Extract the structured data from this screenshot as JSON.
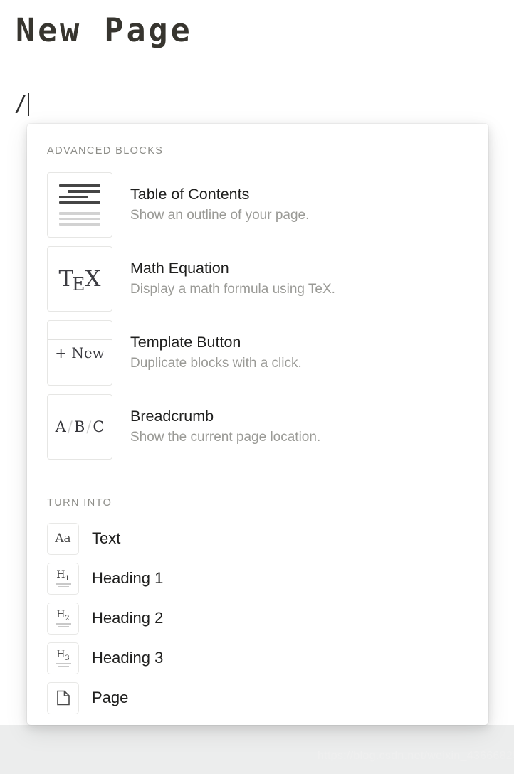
{
  "page": {
    "title": "New Page",
    "typed_text": "/",
    "caret_visible": true
  },
  "slash_menu": {
    "sections": [
      {
        "header": "ADVANCED BLOCKS",
        "items": [
          {
            "title": "Table of Contents",
            "description": "Show an outline of your page.",
            "icon": "table-of-contents-icon"
          },
          {
            "title": "Math Equation",
            "description": "Display a math formula using TeX.",
            "icon": "tex-logo-icon",
            "icon_text": "TEX"
          },
          {
            "title": "Template Button",
            "description": "Duplicate blocks with a click.",
            "icon": "new-template-button-icon",
            "icon_text": "+ New"
          },
          {
            "title": "Breadcrumb",
            "description": "Show the current page location.",
            "icon": "breadcrumb-abc-icon",
            "icon_text": "A / B / C"
          }
        ]
      },
      {
        "header": "TURN INTO",
        "items": [
          {
            "label": "Text",
            "icon": "text-aa-icon",
            "icon_text": "Aa"
          },
          {
            "label": "Heading 1",
            "icon": "heading-1-icon",
            "icon_text": "H1"
          },
          {
            "label": "Heading 2",
            "icon": "heading-2-icon",
            "icon_text": "H2"
          },
          {
            "label": "Heading 3",
            "icon": "heading-3-icon",
            "icon_text": "H3"
          },
          {
            "label": "Page",
            "icon": "page-document-icon",
            "icon_text": ""
          }
        ]
      }
    ]
  },
  "watermark": {
    "text": "https://blog.csdn.net/weixin_43666825"
  },
  "colors": {
    "title_text": "#37352f",
    "item_title": "#1f1f1e",
    "item_description": "#9a9a96",
    "section_header": "#8d8d88",
    "panel_background": "#ffffff",
    "page_background": "#ffffff",
    "below_panel_background": "#eceded",
    "icon_border": "#e6e6e4",
    "divider": "#ecebea",
    "watermark": "#efefef"
  }
}
